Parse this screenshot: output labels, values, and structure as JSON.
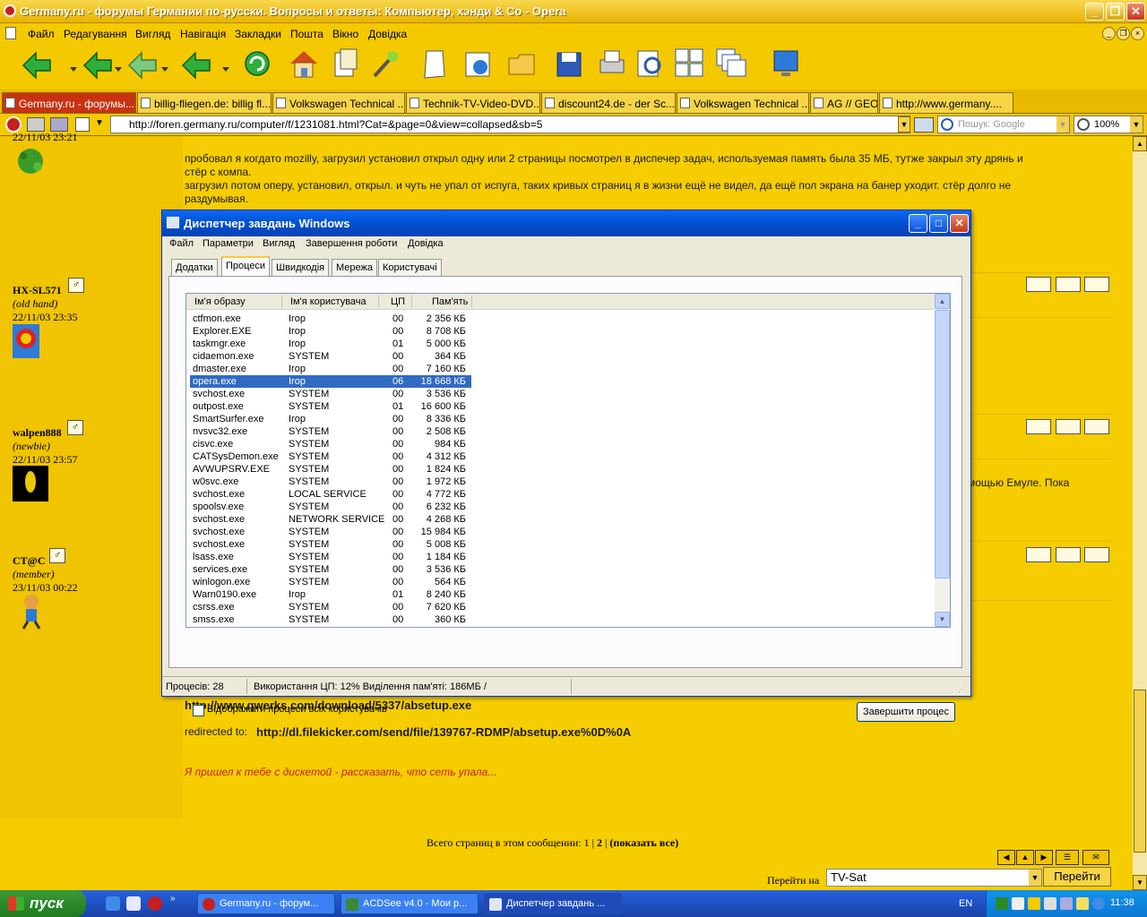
{
  "window": {
    "title": "Germany.ru - форумы Германии по-русски. Вопросы и ответы: Компьютер, хэнди & Co - Opera"
  },
  "menu": [
    "Файл",
    "Редагування",
    "Вигляд",
    "Навігація",
    "Закладки",
    "Пошта",
    "Вікно",
    "Довідка"
  ],
  "tabs": [
    {
      "label": "Germany.ru - форумы...",
      "active": true
    },
    {
      "label": "billig-fliegen.de: billig fl..."
    },
    {
      "label": "Volkswagen Technical ..."
    },
    {
      "label": "Technik-TV-Video-DVD..."
    },
    {
      "label": "discount24.de - der Sc..."
    },
    {
      "label": "Volkswagen Technical ..."
    },
    {
      "label": "AG // GEO"
    },
    {
      "label": "http://www.germany...."
    }
  ],
  "address": {
    "url": "http://foren.germany.ru/computer/f/1231081.html?Cat=&page=0&view=collapsed&sb=5",
    "search_placeholder": "Пошук: Google",
    "zoom": "100%"
  },
  "posts": {
    "p0": {
      "date": "22/11/03 23:21",
      "line1": "пробовал я когдато mozilly, загрузил установил открыл одну или 2 страницы посмотрел в диспечер задач, используемая память была 35 МБ, тутже закрыл эту дрянь и",
      "line2": "стёр с компа.",
      "line3": "загрузил потом оперу, установил, открыл. и чуть не упал от испуга, таких кривых страниц я в жизни ещё не видел, да ещё пол экрана на банер уходит. стёр долго не",
      "line4": "раздумывая."
    },
    "p1": {
      "name": "HX-SL571",
      "rank": "(old hand)",
      "date": "22/11/03 23:35"
    },
    "p2": {
      "name": "walpen888",
      "rank": "(newbie)",
      "date": "22/11/03 23:57",
      "text": "мощью Емуле. Пока"
    },
    "p3": {
      "name": "CT@C",
      "rank": "(member)",
      "date": "23/11/03 00:22",
      "link1": "http://www.qwerks.com/download/5337/absetup.exe",
      "redirect_label": "redirected to:",
      "link2": "http://dl.filekicker.com/send/file/139767-RDMP/absetup.exe%0D%0A",
      "signature": "Я пришел к тебе с дискетой - рассказать, что сеть упала..."
    },
    "gender_icon": "♂"
  },
  "pages": {
    "label": "Всего страниц в этом сообщении:",
    "p1": "1",
    "sep": "|",
    "p2": "2",
    "sep2": "|",
    "show_all": "(показать все)"
  },
  "goto": {
    "label": "Перейти на",
    "value": "TV-Sat",
    "button": "Перейти"
  },
  "task_manager": {
    "title": "Диспетчер завдань Windows",
    "menu": [
      "Файл",
      "Параметри",
      "Вигляд",
      "Завершення роботи",
      "Довідка"
    ],
    "tabs": [
      "Додатки",
      "Процеси",
      "Швидкодія",
      "Мережа",
      "Користувачі"
    ],
    "selected_tab": "Процеси",
    "columns": [
      "Ім'я образу",
      "Ім'я користувача",
      "ЦП",
      "Пам'ять"
    ],
    "rows": [
      [
        "ctfmon.exe",
        "Irop",
        "00",
        "2 356 КБ"
      ],
      [
        "Explorer.EXE",
        "Irop",
        "00",
        "8 708 КБ"
      ],
      [
        "taskmgr.exe",
        "Irop",
        "01",
        "5 000 КБ"
      ],
      [
        "cidaemon.exe",
        "SYSTEM",
        "00",
        "364 КБ"
      ],
      [
        "dmaster.exe",
        "Irop",
        "00",
        "7 160 КБ"
      ],
      [
        "opera.exe",
        "Irop",
        "06",
        "18 668 КБ"
      ],
      [
        "svchost.exe",
        "SYSTEM",
        "00",
        "3 536 КБ"
      ],
      [
        "outpost.exe",
        "SYSTEM",
        "01",
        "16 600 КБ"
      ],
      [
        "SmartSurfer.exe",
        "Irop",
        "00",
        "8 336 КБ"
      ],
      [
        "nvsvc32.exe",
        "SYSTEM",
        "00",
        "2 508 КБ"
      ],
      [
        "cisvc.exe",
        "SYSTEM",
        "00",
        "984 КБ"
      ],
      [
        "CATSysDemon.exe",
        "SYSTEM",
        "00",
        "4 312 КБ"
      ],
      [
        "AVWUPSRV.EXE",
        "SYSTEM",
        "00",
        "1 824 КБ"
      ],
      [
        "w0svc.exe",
        "SYSTEM",
        "00",
        "1 972 КБ"
      ],
      [
        "svchost.exe",
        "LOCAL SERVICE",
        "00",
        "4 772 КБ"
      ],
      [
        "spoolsv.exe",
        "SYSTEM",
        "00",
        "6 232 КБ"
      ],
      [
        "svchost.exe",
        "NETWORK SERVICE",
        "00",
        "4 268 КБ"
      ],
      [
        "svchost.exe",
        "SYSTEM",
        "00",
        "15 984 КБ"
      ],
      [
        "svchost.exe",
        "SYSTEM",
        "00",
        "5 008 КБ"
      ],
      [
        "lsass.exe",
        "SYSTEM",
        "00",
        "1 184 КБ"
      ],
      [
        "services.exe",
        "SYSTEM",
        "00",
        "3 536 КБ"
      ],
      [
        "winlogon.exe",
        "SYSTEM",
        "00",
        "564 КБ"
      ],
      [
        "Warn0190.exe",
        "Irop",
        "01",
        "8 240 КБ"
      ],
      [
        "csrss.exe",
        "SYSTEM",
        "00",
        "7 620 КБ"
      ],
      [
        "smss.exe",
        "SYSTEM",
        "00",
        "360 КБ"
      ]
    ],
    "selected_row": 5,
    "show_all_label": "Відображати процеси всіх користувачів",
    "end_button": "Завершити процес",
    "status": {
      "processes": "Процесів: 28",
      "cpu_mem": "Використання ЦП: 12% Виділення пам'яті: 186МБ /"
    }
  },
  "taskbar": {
    "start": "пуск",
    "tasks": [
      "Germany.ru - форум...",
      "ACDSee v4.0 - Мои р...",
      "Диспетчер завдань ..."
    ],
    "active_task": 2,
    "lang": "EN",
    "time": "11:38"
  },
  "colors": {
    "page_bg": "#f5cd00",
    "opera_chrome": "#f4c900",
    "xp_blue": "#0250d0",
    "selection": "#316ac5",
    "signature": "#c81e1e"
  }
}
